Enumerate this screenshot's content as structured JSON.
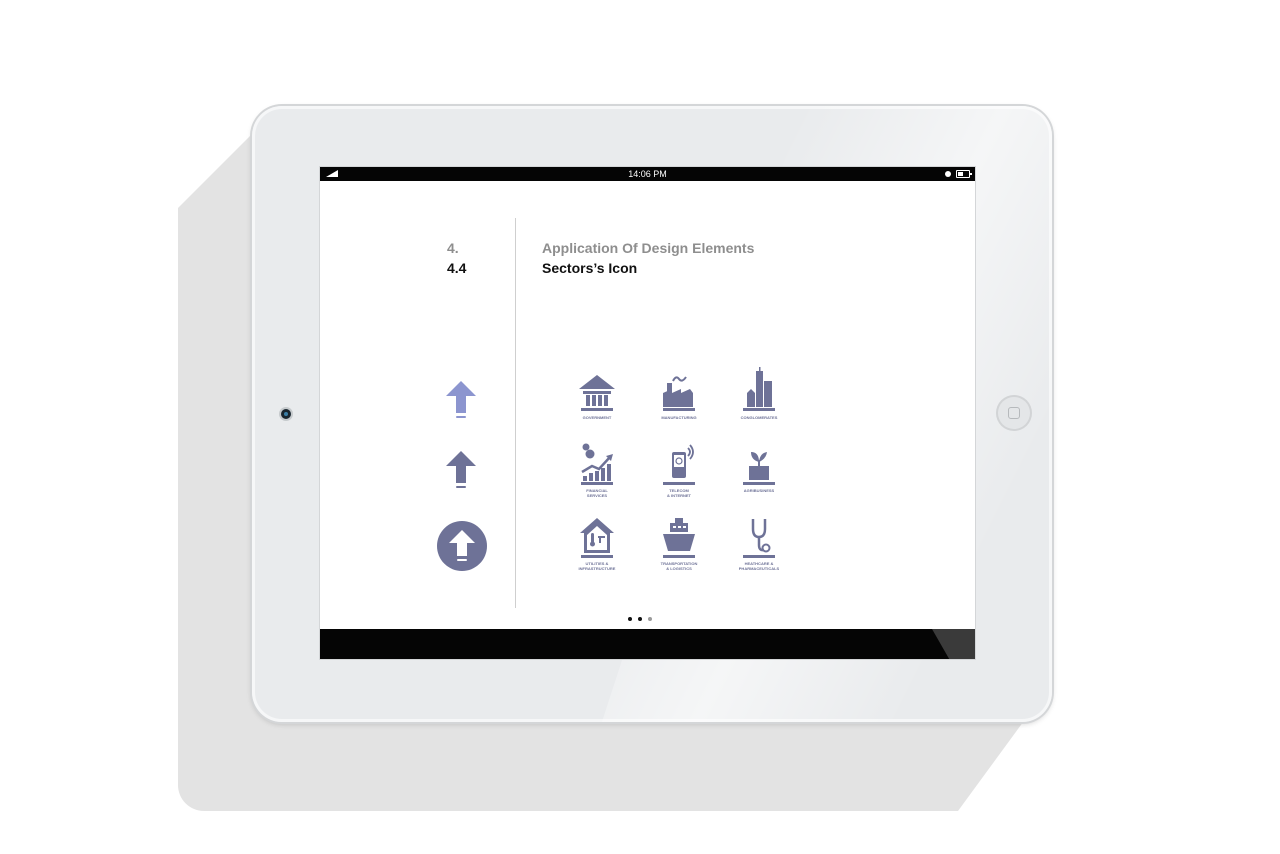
{
  "status_bar": {
    "time": "14:06 PM"
  },
  "header": {
    "section_number": "4.",
    "subsection_number": "4.4",
    "section_title": "Application Of Design Elements",
    "subsection_title": "Sectors’s Icon"
  },
  "arrow_icons": [
    "arrow-up-light-icon",
    "arrow-up-dark-icon",
    "arrow-up-circle-icon"
  ],
  "sector_icons": [
    {
      "icon": "government-icon",
      "label": "GOVERNMENT"
    },
    {
      "icon": "manufacturing-icon",
      "label": "MANUFACTURING"
    },
    {
      "icon": "conglomerates-icon",
      "label": "CONGLOMERATES"
    },
    {
      "icon": "financial-services-icon",
      "label": "FINANCIAL\nSERVICES"
    },
    {
      "icon": "telecom-internet-icon",
      "label": "TELECOM\n& INTERNET"
    },
    {
      "icon": "agribusiness-icon",
      "label": "AGRIBUSINESS"
    },
    {
      "icon": "utilities-infrastructure-icon",
      "label": "UTILITIES &\nINFRASTRUCTURE"
    },
    {
      "icon": "transportation-logistics-icon",
      "label": "TRANSPORTATION\n& LOGISTICS"
    },
    {
      "icon": "healthcare-pharmaceuticals-icon",
      "label": "HEATHCARE &\nPHARMACEUTICALS"
    }
  ],
  "pagination": {
    "pages": 3,
    "active_dots": 2
  },
  "colors": {
    "icon": "#6e7297",
    "icon_light": "#8c95cf",
    "muted_heading": "#8e8e8e",
    "heading": "#111111"
  }
}
